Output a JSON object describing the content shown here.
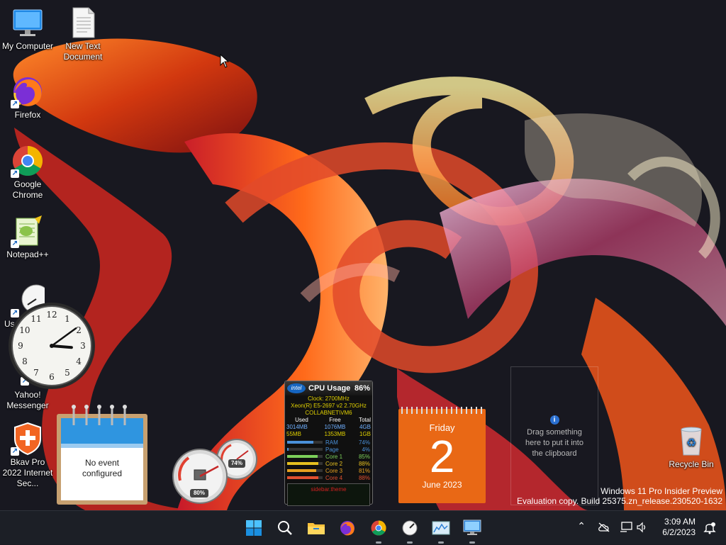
{
  "desktop": {
    "icons": [
      {
        "label": "My Computer",
        "icon": "monitor-icon"
      },
      {
        "label": "New Text Document",
        "icon": "text-file-icon"
      },
      {
        "label": "Firefox",
        "icon": "firefox-icon"
      },
      {
        "label": "Google Chrome",
        "icon": "chrome-icon"
      },
      {
        "label": "Notepad++",
        "icon": "notepad-plus-plus-icon"
      },
      {
        "label": "Us",
        "icon": "gauge-icon"
      },
      {
        "label": "Yahoo! Messenger",
        "icon": "yahoo-messenger-icon"
      },
      {
        "label": "Bkav Pro 2022 Internet Sec...",
        "icon": "bkav-shield-icon"
      },
      {
        "label": "Recycle Bin",
        "icon": "recycle-bin-icon"
      }
    ]
  },
  "gadgets": {
    "analog_clock": {
      "hour": 3,
      "minute": 9
    },
    "notepad": {
      "text": "No event configured"
    },
    "meters": {
      "cpu_percent": "80%",
      "memory_percent": "74%"
    },
    "cpu_usage": {
      "title": "CPU Usage",
      "percent": "86%",
      "clock": "Clock: 2700MHz",
      "cpu_name": "Xeon(R) E5-2697 v2 2.70GHz",
      "host": "COLLABNET\\VM6",
      "table_headers": [
        "Used",
        "Free",
        "Total"
      ],
      "table_rows": [
        [
          "3014MB",
          "1076MB",
          "4GB"
        ],
        [
          "55MB",
          "1353MB",
          "1GB"
        ]
      ],
      "rows": [
        {
          "label": "RAM",
          "value": "74%",
          "level": 0.74,
          "color": "#4a90d9"
        },
        {
          "label": "Page",
          "value": "4%",
          "level": 0.04,
          "color": "#4a90d9"
        },
        {
          "label": "Core 1",
          "value": "85%",
          "level": 0.85,
          "color": "#7ccf5a"
        },
        {
          "label": "Core 2",
          "value": "88%",
          "level": 0.88,
          "color": "#e6c020"
        },
        {
          "label": "Core 3",
          "value": "81%",
          "level": 0.81,
          "color": "#e6a020"
        },
        {
          "label": "Core 4",
          "value": "88%",
          "level": 0.88,
          "color": "#e05030"
        }
      ],
      "graph_error": "sidebar.theme"
    },
    "calendar": {
      "weekday": "Friday",
      "day": "2",
      "month_year": "June 2023"
    },
    "clipboard": {
      "text": "Drag something here to put it into the clipboard"
    }
  },
  "watermark": {
    "line1": "Windows 11 Pro Insider Preview",
    "line2": "Evaluation copy. Build 25375.zn_release.230520-1632"
  },
  "taskbar": {
    "apps": [
      {
        "name": "start-button",
        "icon": "windows-logo-icon",
        "running": false
      },
      {
        "name": "search-button",
        "icon": "search-icon",
        "running": false
      },
      {
        "name": "file-explorer-button",
        "icon": "folder-icon",
        "running": false
      },
      {
        "name": "firefox-button",
        "icon": "firefox-icon",
        "running": false
      },
      {
        "name": "chrome-button",
        "icon": "chrome-icon",
        "running": true
      },
      {
        "name": "gadgets-button",
        "icon": "gauge-icon",
        "running": true
      },
      {
        "name": "monitor-app-button",
        "icon": "chart-window-icon",
        "running": true
      },
      {
        "name": "remote-desktop-button",
        "icon": "computer-window-icon",
        "running": true
      }
    ],
    "tray": {
      "time": "3:09 AM",
      "date": "6/2/2023"
    }
  }
}
